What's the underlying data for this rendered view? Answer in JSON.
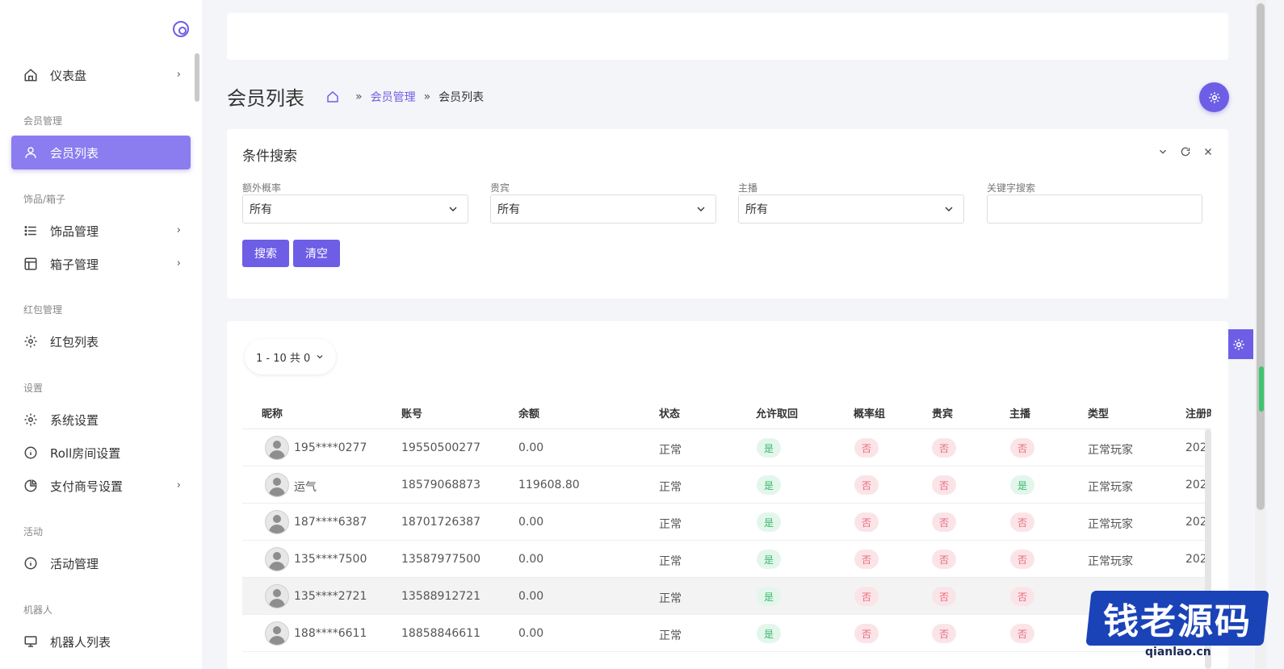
{
  "sidebar": {
    "items": [
      {
        "label": "仪表盘",
        "icon": "home-icon",
        "arrow": "›"
      },
      {
        "label": "会员列表",
        "icon": "user-icon"
      },
      {
        "label": "饰品管理",
        "icon": "list-icon",
        "arrow": "›"
      },
      {
        "label": "箱子管理",
        "icon": "box-icon",
        "arrow": "›"
      },
      {
        "label": "红包列表",
        "icon": "gear-icon"
      },
      {
        "label": "系统设置",
        "icon": "gear-icon"
      },
      {
        "label": "Roll房间设置",
        "icon": "info-icon"
      },
      {
        "label": "支付商号设置",
        "icon": "pie-chart-icon",
        "arrow": "›"
      },
      {
        "label": "活动管理",
        "icon": "info-icon"
      },
      {
        "label": "机器人列表",
        "icon": "monitor-icon"
      }
    ],
    "sections": [
      "会员管理",
      "饰品/箱子",
      "红包管理",
      "设置",
      "活动",
      "机器人"
    ]
  },
  "header": {
    "title": "会员列表",
    "breadcrumb": {
      "sep": "»",
      "link": "会员管理",
      "current": "会员列表"
    }
  },
  "search": {
    "title": "条件搜索",
    "fields": [
      {
        "label": "额外概率",
        "value": "所有"
      },
      {
        "label": "贵宾",
        "value": "所有"
      },
      {
        "label": "主播",
        "value": "所有"
      },
      {
        "label": "关键字搜索",
        "value": ""
      }
    ],
    "search_label": "搜索",
    "clear_label": "清空"
  },
  "table": {
    "pager": "1 - 10 共 0",
    "columns": [
      "昵称",
      "账号",
      "余额",
      "状态",
      "允许取回",
      "概率组",
      "贵宾",
      "主播",
      "类型",
      "注册时"
    ],
    "rows": [
      {
        "nick": "195****0277",
        "account": "19550500277",
        "balance": "0.00",
        "status": "正常",
        "retrieve": "是",
        "prob": "否",
        "vip": "否",
        "anchor": "否",
        "type": "正常玩家",
        "reg": "202"
      },
      {
        "nick": "运气",
        "account": "18579068873",
        "balance": "119608.80",
        "status": "正常",
        "retrieve": "是",
        "prob": "否",
        "vip": "否",
        "anchor": "是",
        "type": "正常玩家",
        "reg": "202"
      },
      {
        "nick": "187****6387",
        "account": "18701726387",
        "balance": "0.00",
        "status": "正常",
        "retrieve": "是",
        "prob": "否",
        "vip": "否",
        "anchor": "否",
        "type": "正常玩家",
        "reg": "202"
      },
      {
        "nick": "135****7500",
        "account": "13587977500",
        "balance": "0.00",
        "status": "正常",
        "retrieve": "是",
        "prob": "否",
        "vip": "否",
        "anchor": "否",
        "type": "正常玩家",
        "reg": "202"
      },
      {
        "nick": "135****2721",
        "account": "13588912721",
        "balance": "0.00",
        "status": "正常",
        "retrieve": "是",
        "prob": "否",
        "vip": "否",
        "anchor": "否",
        "type": "",
        "reg": ""
      },
      {
        "nick": "188****6611",
        "account": "18858846611",
        "balance": "0.00",
        "status": "正常",
        "retrieve": "是",
        "prob": "否",
        "vip": "否",
        "anchor": "否",
        "type": "",
        "reg": ""
      }
    ]
  },
  "watermark": {
    "text": "钱老源码",
    "url": "qianlao.cn"
  },
  "colors": {
    "accent": "#6e5ee6",
    "sidebar_active": "#8b7cf0",
    "yes_bg": "#e3f6ec",
    "yes_fg": "#39b86b",
    "no_bg": "#fbe4e7",
    "no_fg": "#e86b7d"
  }
}
